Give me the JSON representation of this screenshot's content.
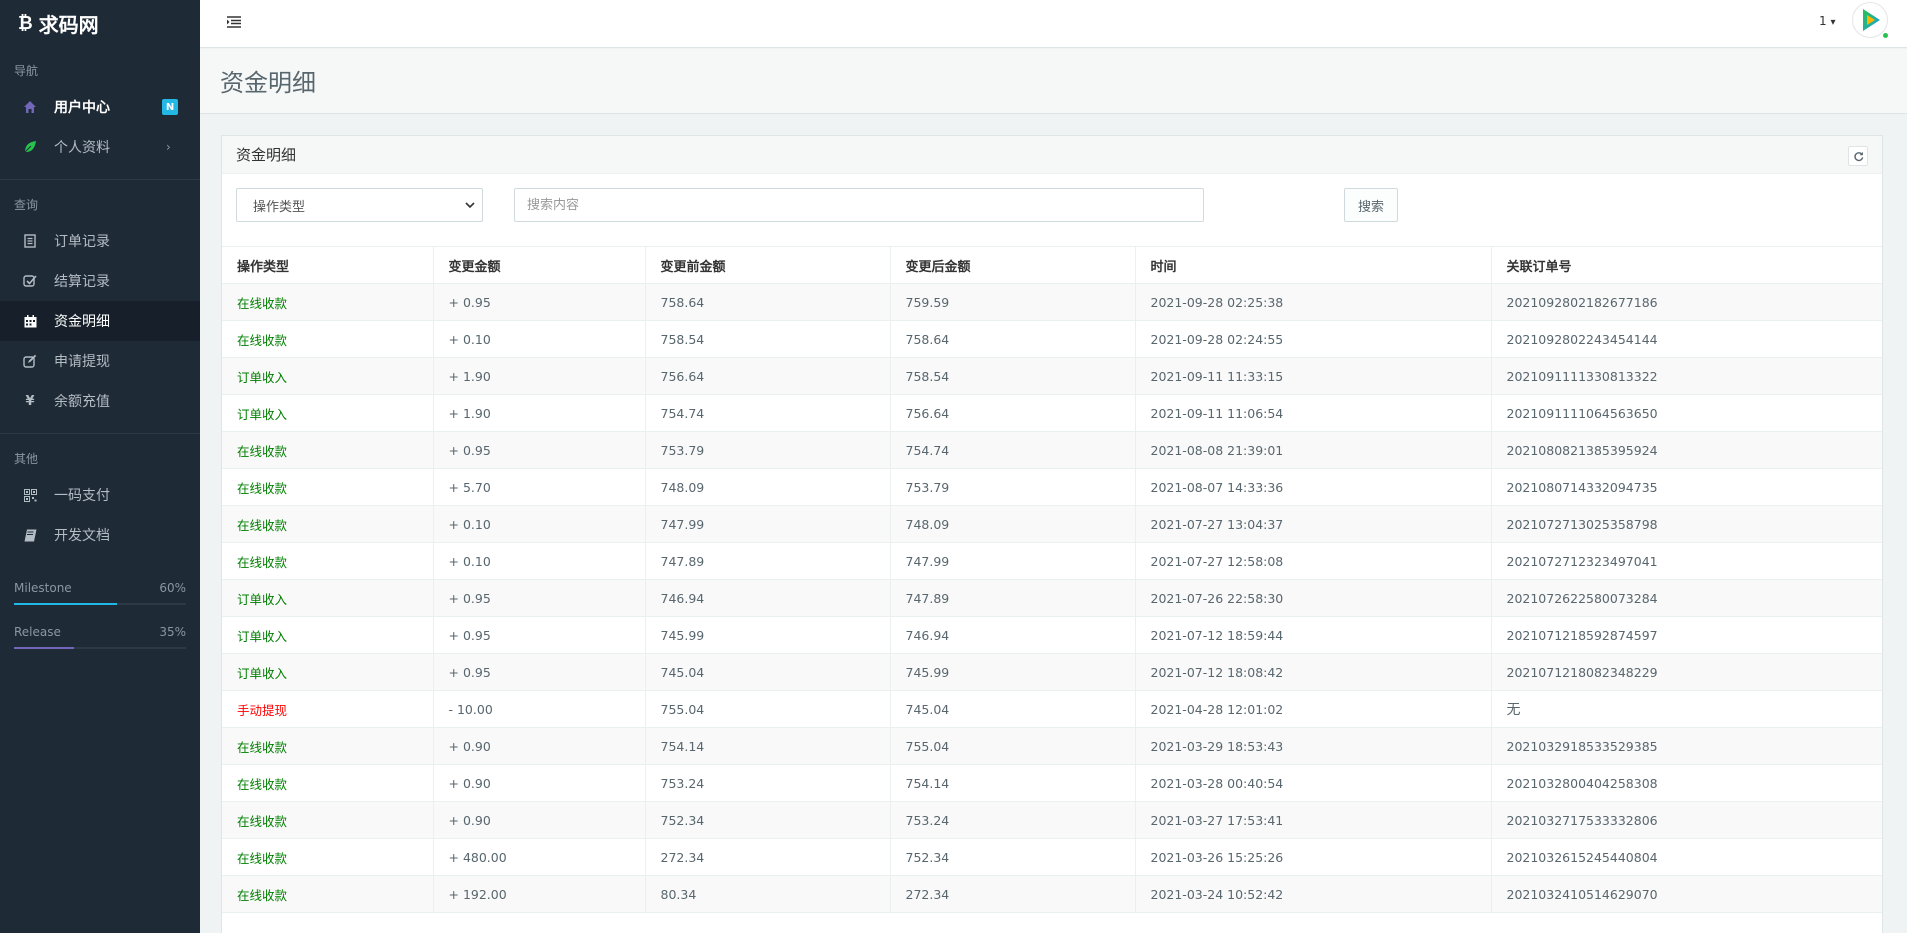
{
  "brand": {
    "logo_glyph": "₿",
    "name": "求码网"
  },
  "sidebar": {
    "sections": [
      {
        "label": "导航"
      },
      {
        "label": "查询"
      },
      {
        "label": "其他"
      }
    ],
    "items": [
      {
        "label": "用户中心",
        "badge": "N"
      },
      {
        "label": "个人资料",
        "chevron": "›"
      },
      {
        "label": "订单记录"
      },
      {
        "label": "结算记录"
      },
      {
        "label": "资金明细"
      },
      {
        "label": "申请提现"
      },
      {
        "label": "余额充值"
      },
      {
        "label": "一码支付"
      },
      {
        "label": "开发文档"
      }
    ],
    "progress": [
      {
        "label": "Milestone",
        "value_text": "60%",
        "value": 0.6,
        "color": "#23b7e5"
      },
      {
        "label": "Release",
        "value_text": "35%",
        "value": 0.35,
        "color": "#7266ba"
      }
    ]
  },
  "header": {
    "user_number": "1",
    "caret": "▾"
  },
  "page": {
    "title": "资金明细"
  },
  "panel": {
    "title": "资金明细",
    "filter": {
      "select_value": "操作类型",
      "search_placeholder": "搜索内容",
      "search_button": "搜索"
    },
    "columns": [
      "操作类型",
      "变更金额",
      "变更前金额",
      "变更后金额",
      "时间",
      "关联订单号"
    ],
    "rows": [
      {
        "type": "在线收款",
        "status": "green",
        "amount": "+ 0.95",
        "before": "758.64",
        "after": "759.59",
        "time": "2021-09-28 02:25:38",
        "order": "2021092802182677186"
      },
      {
        "type": "在线收款",
        "status": "green",
        "amount": "+ 0.10",
        "before": "758.54",
        "after": "758.64",
        "time": "2021-09-28 02:24:55",
        "order": "2021092802243454144"
      },
      {
        "type": "订单收入",
        "status": "green",
        "amount": "+ 1.90",
        "before": "756.64",
        "after": "758.54",
        "time": "2021-09-11 11:33:15",
        "order": "2021091111330813322"
      },
      {
        "type": "订单收入",
        "status": "green",
        "amount": "+ 1.90",
        "before": "754.74",
        "after": "756.64",
        "time": "2021-09-11 11:06:54",
        "order": "2021091111064563650"
      },
      {
        "type": "在线收款",
        "status": "green",
        "amount": "+ 0.95",
        "before": "753.79",
        "after": "754.74",
        "time": "2021-08-08 21:39:01",
        "order": "2021080821385395924"
      },
      {
        "type": "在线收款",
        "status": "green",
        "amount": "+ 5.70",
        "before": "748.09",
        "after": "753.79",
        "time": "2021-08-07 14:33:36",
        "order": "2021080714332094735"
      },
      {
        "type": "在线收款",
        "status": "green",
        "amount": "+ 0.10",
        "before": "747.99",
        "after": "748.09",
        "time": "2021-07-27 13:04:37",
        "order": "2021072713025358798"
      },
      {
        "type": "在线收款",
        "status": "green",
        "amount": "+ 0.10",
        "before": "747.89",
        "after": "747.99",
        "time": "2021-07-27 12:58:08",
        "order": "2021072712323497041"
      },
      {
        "type": "订单收入",
        "status": "green",
        "amount": "+ 0.95",
        "before": "746.94",
        "after": "747.89",
        "time": "2021-07-26 22:58:30",
        "order": "2021072622580073284"
      },
      {
        "type": "订单收入",
        "status": "green",
        "amount": "+ 0.95",
        "before": "745.99",
        "after": "746.94",
        "time": "2021-07-12 18:59:44",
        "order": "2021071218592874597"
      },
      {
        "type": "订单收入",
        "status": "green",
        "amount": "+ 0.95",
        "before": "745.04",
        "after": "745.99",
        "time": "2021-07-12 18:08:42",
        "order": "2021071218082348229"
      },
      {
        "type": "手动提现",
        "status": "red",
        "amount": "- 10.00",
        "before": "755.04",
        "after": "745.04",
        "time": "2021-04-28 12:01:02",
        "order": "无"
      },
      {
        "type": "在线收款",
        "status": "green",
        "amount": "+ 0.90",
        "before": "754.14",
        "after": "755.04",
        "time": "2021-03-29 18:53:43",
        "order": "2021032918533529385"
      },
      {
        "type": "在线收款",
        "status": "green",
        "amount": "+ 0.90",
        "before": "753.24",
        "after": "754.14",
        "time": "2021-03-28 00:40:54",
        "order": "2021032800404258308"
      },
      {
        "type": "在线收款",
        "status": "green",
        "amount": "+ 0.90",
        "before": "752.34",
        "after": "753.24",
        "time": "2021-03-27 17:53:41",
        "order": "2021032717533332806"
      },
      {
        "type": "在线收款",
        "status": "green",
        "amount": "+ 480.00",
        "before": "272.34",
        "after": "752.34",
        "time": "2021-03-26 15:25:26",
        "order": "2021032615245440804"
      },
      {
        "type": "在线收款",
        "status": "green",
        "amount": "+ 192.00",
        "before": "80.34",
        "after": "272.34",
        "time": "2021-03-24 10:52:42",
        "order": "2021032410514629070"
      }
    ]
  },
  "colors": {
    "sidebar_bg": "#1e2a36",
    "accent": "#23b7e5",
    "green": "#008000",
    "red": "#ff0000"
  }
}
